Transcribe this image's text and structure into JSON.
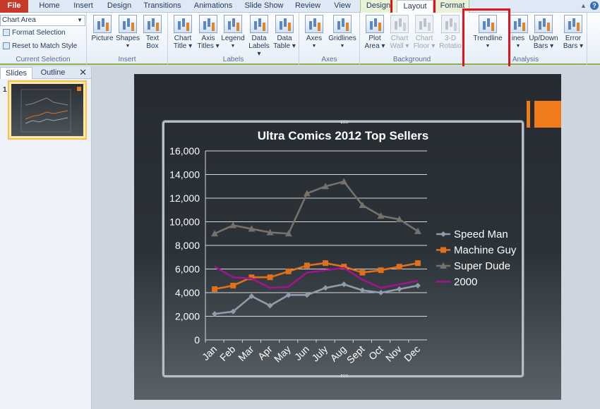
{
  "tabs": {
    "file": "File",
    "home": "Home",
    "insert": "Insert",
    "design": "Design",
    "transitions": "Transitions",
    "animations": "Animations",
    "slideshow": "Slide Show",
    "review": "Review",
    "view": "View",
    "chart_design": "Design",
    "chart_layout": "Layout",
    "chart_format": "Format"
  },
  "ribbon": {
    "current_selection": {
      "dropdown_value": "Chart Area",
      "format_selection": "Format Selection",
      "reset_style": "Reset to Match Style",
      "label": "Current Selection"
    },
    "insert": {
      "picture": "Picture",
      "shapes": "Shapes",
      "text_box_1": "Text",
      "text_box_2": "Box",
      "label": "Insert"
    },
    "labels": {
      "chart_title_1": "Chart",
      "chart_title_2": "Title",
      "axis_titles_1": "Axis",
      "axis_titles_2": "Titles",
      "legend": "Legend",
      "data_labels_1": "Data",
      "data_labels_2": "Labels",
      "data_table_1": "Data",
      "data_table_2": "Table",
      "label": "Labels"
    },
    "axes": {
      "axes": "Axes",
      "gridlines": "Gridlines",
      "label": "Axes"
    },
    "background": {
      "plot_area_1": "Plot",
      "plot_area_2": "Area",
      "chart_wall_1": "Chart",
      "chart_wall_2": "Wall",
      "chart_floor_1": "Chart",
      "chart_floor_2": "Floor",
      "rotation_1": "3-D",
      "rotation_2": "Rotatio",
      "label": "Background"
    },
    "analysis": {
      "trendline": "Trendline",
      "lines": "ines",
      "updown_1": "Up/Down",
      "updown_2": "Bars",
      "error_1": "Error",
      "error_2": "Bars",
      "label": "Analysis"
    }
  },
  "left_panel": {
    "slides_tab": "Slides",
    "outline_tab": "Outline",
    "close": "✕",
    "slide_number": "1"
  },
  "colors": {
    "speed_man": "#8e9dab",
    "machine_guy": "#e0701a",
    "super_dude": "#77716b",
    "y2000": "#a0148c",
    "highlight": "#e0141c"
  },
  "chart_data": {
    "type": "line",
    "title": "Ultra Comics 2012 Top Sellers",
    "categories": [
      "Jan",
      "Feb",
      "Mar",
      "Apr",
      "May",
      "Jun",
      "July",
      "Aug",
      "Sept",
      "Oct",
      "Nov",
      "Dec"
    ],
    "ylim": [
      0,
      16000
    ],
    "yticks": [
      "0",
      "2,000",
      "4,000",
      "6,000",
      "8,000",
      "10,000",
      "12,000",
      "14,000",
      "16,000"
    ],
    "legend_position": "right",
    "grid": true,
    "series": [
      {
        "name": "Speed Man",
        "marker": "diamond",
        "values": [
          2200,
          2400,
          3700,
          2900,
          3800,
          3800,
          4400,
          4700,
          4200,
          4000,
          4300,
          4600
        ]
      },
      {
        "name": "Machine Guy",
        "marker": "square",
        "values": [
          4300,
          4600,
          5300,
          5300,
          5800,
          6300,
          6500,
          6200,
          5700,
          5900,
          6200,
          6500
        ]
      },
      {
        "name": "Super Dude",
        "marker": "triangle",
        "values": [
          9000,
          9700,
          9400,
          9100,
          9000,
          12400,
          13000,
          13400,
          11400,
          10500,
          10200,
          9200
        ]
      },
      {
        "name": "2000",
        "marker": "none",
        "values": [
          6200,
          5300,
          5200,
          4400,
          4500,
          5700,
          5900,
          6100,
          5100,
          4400,
          4700,
          5000
        ]
      }
    ]
  }
}
